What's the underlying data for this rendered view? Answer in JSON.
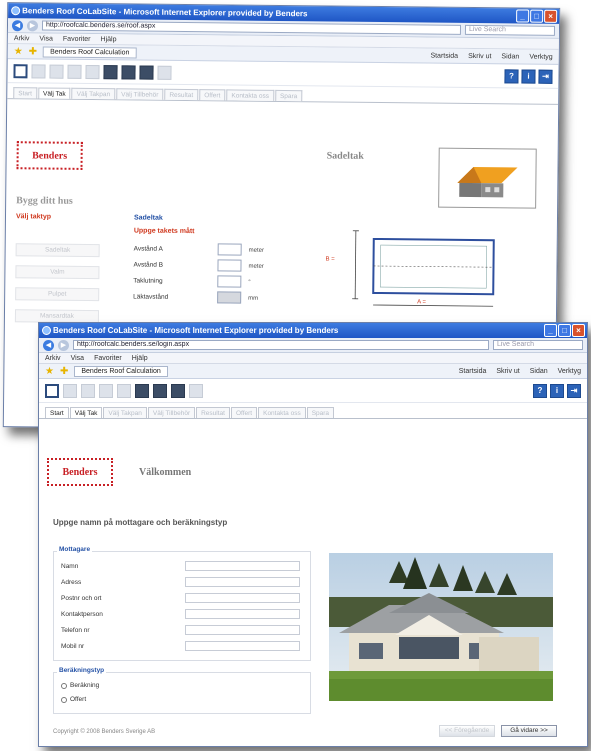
{
  "window_back": {
    "title": "Benders Roof CoLabSite - Microsoft Internet Explorer provided by Benders",
    "url": "http://roofcalc.benders.se/roof.aspx",
    "search_placeholder": "Live Search",
    "menu": [
      "Arkiv",
      "Visa",
      "Favoriter",
      "Hjälp"
    ],
    "fav_tab": "Benders Roof Calculation",
    "right_tools": [
      "Startsida",
      "Skriv ut",
      "Sidan",
      "Verktyg"
    ],
    "tabs": [
      {
        "label": "Start",
        "active": false
      },
      {
        "label": "Välj Tak",
        "active": true
      },
      {
        "label": "Välj Takpan",
        "active": false
      },
      {
        "label": "Välj Tillbehör",
        "active": false
      },
      {
        "label": "Resultat",
        "active": false
      },
      {
        "label": "Offert",
        "active": false
      },
      {
        "label": "Kontakta oss",
        "active": false
      },
      {
        "label": "Spara",
        "active": false
      }
    ],
    "logo": "Benders",
    "page_title": "Sadeltak",
    "side_title": "Bygg ditt hus",
    "side_link": "Välj taktyp",
    "side_buttons": [
      "Sadeltak",
      "Valm",
      "Pulpet",
      "Mansardtak"
    ],
    "section_title": "Sadeltak",
    "section_subtitle": "Uppge takets mått",
    "rows": [
      {
        "label": "Avstånd A",
        "unit": "meter"
      },
      {
        "label": "Avstånd B",
        "unit": "meter"
      },
      {
        "label": "Taklutning",
        "unit": "°"
      },
      {
        "label": "Läktavstånd",
        "unit": "mm"
      }
    ],
    "dim_a": "A =",
    "dim_b": "B ="
  },
  "window_front": {
    "title": "Benders Roof CoLabSite - Microsoft Internet Explorer provided by Benders",
    "url": "http://roofcalc.benders.se/login.aspx",
    "search_placeholder": "Live Search",
    "menu": [
      "Arkiv",
      "Visa",
      "Favoriter",
      "Hjälp"
    ],
    "fav_tab": "Benders Roof Calculation",
    "right_tools": [
      "Startsida",
      "Skriv ut",
      "Sidan",
      "Verktyg"
    ],
    "tabs": [
      {
        "label": "Start",
        "active": true
      },
      {
        "label": "Välj Tak",
        "active": false
      },
      {
        "label": "Välj Takpan",
        "active": false
      },
      {
        "label": "Välj Tillbehör",
        "active": false
      },
      {
        "label": "Resultat",
        "active": false
      },
      {
        "label": "Offert",
        "active": false
      },
      {
        "label": "Kontakta oss",
        "active": false
      },
      {
        "label": "Spara",
        "active": false
      }
    ],
    "logo": "Benders",
    "welcome": "Välkommen",
    "instruction": "Uppge namn på mottagare och beräkningstyp",
    "recipient_legend": "Mottagare",
    "fields": [
      {
        "label": "Namn",
        "value": ""
      },
      {
        "label": "Adress",
        "value": ""
      },
      {
        "label": "Postnr och ort",
        "value": ""
      },
      {
        "label": "Kontaktperson",
        "value": ""
      },
      {
        "label": "Telefon nr",
        "value": ""
      },
      {
        "label": "Mobil nr",
        "value": ""
      }
    ],
    "calc_legend": "Beräkningstyp",
    "radio_options": [
      "Beräkning",
      "Offert"
    ],
    "footer": "Copyright © 2008 Benders Sverige AB",
    "btn_prev": "<< Föregående",
    "btn_next": "Gå vidare >>"
  },
  "colors": {
    "title_blue": "#1f56c5",
    "brand_red": "#c82025",
    "link_blue": "#2552a6"
  }
}
